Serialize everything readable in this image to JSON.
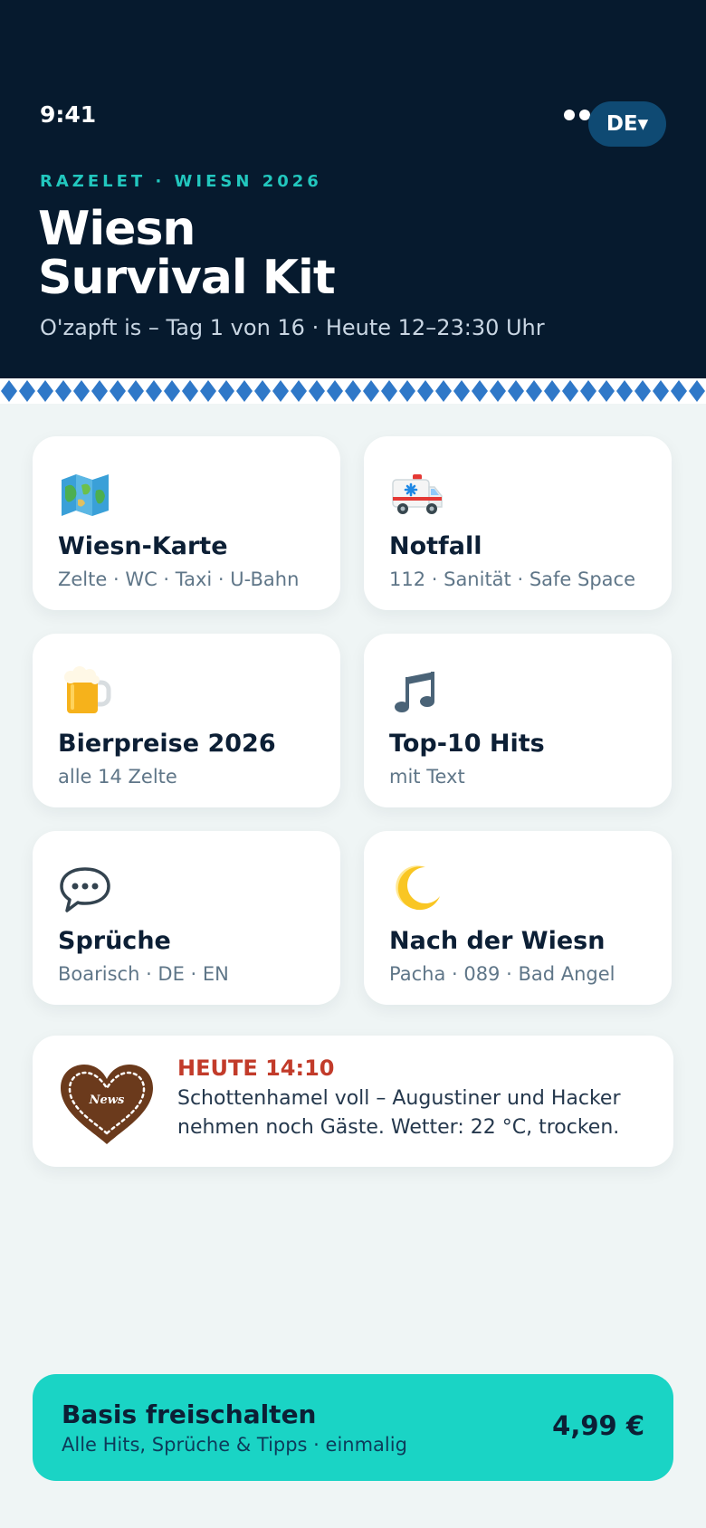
{
  "status_bar": {
    "time": "9:41"
  },
  "header": {
    "language": "DE▾",
    "kicker": "RAZELET · WIESN 2026",
    "title_line1": "Wiesn",
    "title_line2": "Survival Kit",
    "subtitle": "O'zapft is – Tag 1 von 16 · Heute 12–23:30 Uhr"
  },
  "tiles": [
    {
      "icon": "map-icon",
      "title": "Wiesn-Karte",
      "subtitle": "Zelte · WC · Taxi · U-Bahn"
    },
    {
      "icon": "ambulance-icon",
      "title": "Notfall",
      "subtitle": "112 · Sanität · Safe Space"
    },
    {
      "icon": "beer-mug-icon",
      "title": "Bierpreise 2026",
      "subtitle": "alle 14 Zelte"
    },
    {
      "icon": "music-note-icon",
      "title": "Top-10 Hits",
      "subtitle": "mit Text"
    },
    {
      "icon": "speech-bubble-icon",
      "title": "Sprüche",
      "subtitle": "Boarisch · DE · EN"
    },
    {
      "icon": "crescent-moon-icon",
      "title": "Nach der Wiesn",
      "subtitle": "Pacha · 089 · Bad Angel"
    }
  ],
  "news": {
    "icon": "gingerbread-heart-icon",
    "heart_text": "News",
    "label": "HEUTE 14:10",
    "text": "Schottenhamel voll – Augustiner und Hacker nehmen noch Gäste. Wetter: 22 °C, trocken."
  },
  "cta": {
    "title": "Basis freischalten",
    "subtitle": "Alle Hits, Sprüche & Tipps · einmalig",
    "price": "4,99 €"
  },
  "colors": {
    "header_bg": "#061a2e",
    "accent_teal": "#1ad4c5",
    "news_red": "#c23b2a",
    "bavarian_blue": "#2f78c8"
  }
}
